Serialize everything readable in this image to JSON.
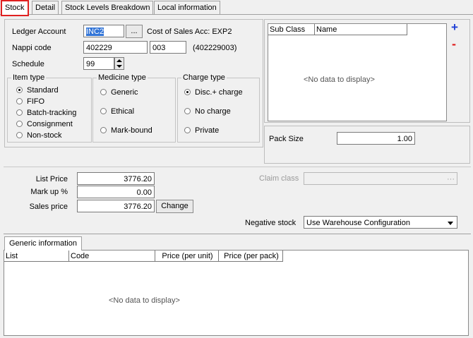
{
  "tabs": [
    {
      "label": "Stock"
    },
    {
      "label": "Detail"
    },
    {
      "label": "Stock Levels Breakdown"
    },
    {
      "label": "Local information"
    }
  ],
  "stock": {
    "ledger_account_label": "Ledger Account",
    "ledger_account_value": "INC2",
    "lookup_button": "...",
    "cost_of_sales_label": "Cost of Sales Acc: EXP2",
    "nappi_label": "Nappi code",
    "nappi_value": "402229",
    "nappi_suffix": "003",
    "nappi_full": "(402229003)",
    "schedule_label": "Schedule",
    "schedule_value": "99",
    "item_type": {
      "title": "Item type",
      "options": [
        "Standard",
        "FIFO",
        "Batch-tracking",
        "Consignment",
        "Non-stock"
      ],
      "selected": "Standard"
    },
    "medicine_type": {
      "title": "Medicine type",
      "options": [
        "Generic",
        "Ethical",
        "Mark-bound"
      ],
      "selected": ""
    },
    "charge_type": {
      "title": "Charge type",
      "options": [
        "Disc.+ charge",
        "No charge",
        "Private"
      ],
      "selected": "Disc.+ charge"
    },
    "subclass_grid": {
      "columns": [
        "Sub Class",
        "Name"
      ],
      "empty_text": "<No data to display>",
      "add_icon": "+",
      "remove_icon": "-"
    },
    "pack_size_label": "Pack Size",
    "pack_size_value": "1.00"
  },
  "pricing": {
    "list_price_label": "List Price",
    "list_price_value": "3776.20",
    "markup_label": "Mark up %",
    "markup_value": "0.00",
    "sales_price_label": "Sales price",
    "sales_price_value": "3776.20",
    "change_button": "Change",
    "claim_class_label": "Claim class",
    "claim_class_button": "···",
    "negative_stock_label": "Negative stock",
    "negative_stock_value": "Use Warehouse Configuration"
  },
  "generic": {
    "tab_label": "Generic information",
    "columns": [
      "List",
      "Code",
      "Price (per unit)",
      "Price (per pack)"
    ],
    "empty_text": "<No data to display>"
  },
  "colors": {
    "active_tab_border": "#e02020",
    "add_icon": "#1f3fd6",
    "remove_icon": "#e02020",
    "selection": "#3375d7"
  }
}
